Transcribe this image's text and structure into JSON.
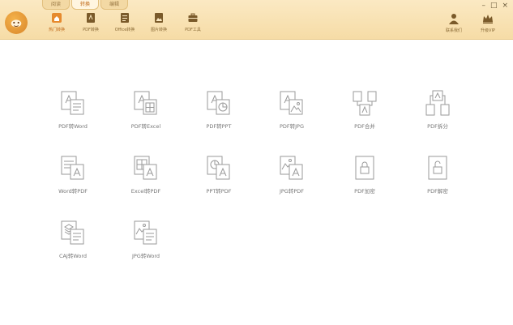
{
  "window_controls": {
    "minimize": "–",
    "maximize": "□",
    "close": "×"
  },
  "tabs": [
    {
      "label": "阅读",
      "active": false
    },
    {
      "label": "转换",
      "active": true
    },
    {
      "label": "编辑",
      "active": false
    }
  ],
  "toolbar": [
    {
      "label": "热门转换",
      "icon": "home-icon",
      "active": true
    },
    {
      "label": "PDF转换",
      "icon": "pdf-icon",
      "active": false
    },
    {
      "label": "Office转换",
      "icon": "office-icon",
      "active": false
    },
    {
      "label": "图片转换",
      "icon": "image-icon",
      "active": false
    },
    {
      "label": "PDF工具",
      "icon": "toolbox-icon",
      "active": false
    }
  ],
  "right_toolbar": [
    {
      "label": "联系我们",
      "icon": "contact-icon"
    },
    {
      "label": "升级VIP",
      "icon": "crown-icon"
    }
  ],
  "functions": [
    {
      "label": "PDF转Word"
    },
    {
      "label": "PDF转Excel"
    },
    {
      "label": "PDF转PPT"
    },
    {
      "label": "PDF转JPG"
    },
    {
      "label": "PDF合并"
    },
    {
      "label": "PDF拆分"
    },
    {
      "label": "Word转PDF"
    },
    {
      "label": "Excel转PDF"
    },
    {
      "label": "PPT转PDF"
    },
    {
      "label": "JPG转PDF"
    },
    {
      "label": "PDF加密"
    },
    {
      "label": "PDF解密"
    },
    {
      "label": "CAJ转Word"
    },
    {
      "label": "JPG转Word"
    }
  ],
  "colors": {
    "accent": "#c06a1a",
    "topbar": "#f6dca6",
    "icon_stroke": "#9a9a9a"
  }
}
